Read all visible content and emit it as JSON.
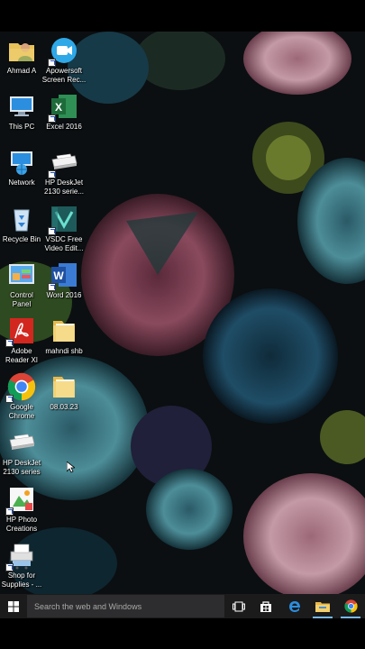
{
  "desktop_icons": [
    {
      "name": "user-folder-icon",
      "label": "Ahmad A",
      "col": 0,
      "row": 0
    },
    {
      "name": "apowersoft-icon",
      "label": "Apowersoft\nScreen Rec...",
      "col": 1,
      "row": 0
    },
    {
      "name": "this-pc-icon",
      "label": "This PC",
      "col": 0,
      "row": 1
    },
    {
      "name": "excel-icon",
      "label": "Excel 2016",
      "col": 1,
      "row": 1
    },
    {
      "name": "network-icon",
      "label": "Network",
      "col": 0,
      "row": 2
    },
    {
      "name": "printer-icon",
      "label": "HP DeskJet\n2130 serie...",
      "col": 1,
      "row": 2
    },
    {
      "name": "recycle-bin-icon",
      "label": "Recycle Bin",
      "col": 0,
      "row": 3
    },
    {
      "name": "vsdc-icon",
      "label": "VSDC Free\nVideo Edit...",
      "col": 1,
      "row": 3
    },
    {
      "name": "control-panel-icon",
      "label": "Control\nPanel",
      "col": 0,
      "row": 4
    },
    {
      "name": "word-icon",
      "label": "Word 2016",
      "col": 1,
      "row": 4
    },
    {
      "name": "adobe-reader-icon",
      "label": "Adobe\nReader XI",
      "col": 0,
      "row": 5
    },
    {
      "name": "folder-icon",
      "label": "mahndi shb",
      "col": 1,
      "row": 5
    },
    {
      "name": "chrome-icon",
      "label": "Google\nChrome",
      "col": 0,
      "row": 6
    },
    {
      "name": "folder-icon",
      "label": "08.03.23",
      "col": 1,
      "row": 6
    },
    {
      "name": "printer-icon",
      "label": "HP DeskJet\n2130 series",
      "col": 0,
      "row": 7
    },
    {
      "name": "hp-photo-icon",
      "label": "HP Photo\nCreations",
      "col": 0,
      "row": 8
    },
    {
      "name": "shop-supplies-icon",
      "label": "Shop for\nSupplies - ...",
      "col": 0,
      "row": 9
    }
  ],
  "taskbar": {
    "search_placeholder": "Search the web and Windows",
    "buttons": [
      "task-view-icon",
      "store-icon",
      "edge-icon",
      "file-explorer-icon",
      "chrome-icon"
    ]
  },
  "colors": {
    "taskbar": "#1b1b1c",
    "search_box": "#2d2d2f",
    "accent": "#76b9ed"
  }
}
